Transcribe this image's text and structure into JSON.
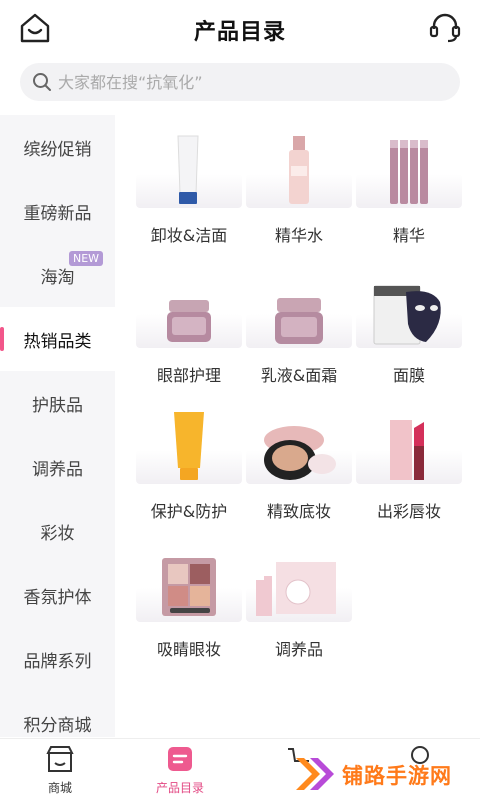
{
  "header": {
    "title": "产品目录"
  },
  "search": {
    "placeholder": "大家都在搜“抗氧化”"
  },
  "sidebar": {
    "items": [
      {
        "label": "缤纷促销"
      },
      {
        "label": "重磅新品"
      },
      {
        "label": "海淘"
      },
      {
        "label": "热销品类"
      },
      {
        "label": "护肤品"
      },
      {
        "label": "调养品"
      },
      {
        "label": "彩妆"
      },
      {
        "label": "香氛护体"
      },
      {
        "label": "品牌系列"
      },
      {
        "label": "积分商城"
      }
    ],
    "active_index": 3,
    "new_badge": "NEW"
  },
  "products": [
    {
      "label": "卸妆&洁面",
      "icon": "cleanser-tube-icon"
    },
    {
      "label": "精华水",
      "icon": "essence-bottle-icon"
    },
    {
      "label": "精华",
      "icon": "serum-vials-icon"
    },
    {
      "label": "眼部护理",
      "icon": "eye-cream-jar-icon"
    },
    {
      "label": "乳液&面霜",
      "icon": "face-cream-jar-icon"
    },
    {
      "label": "面膜",
      "icon": "sheet-mask-icon"
    },
    {
      "label": "保护&防护",
      "icon": "sunscreen-tube-icon"
    },
    {
      "label": "精致底妆",
      "icon": "cushion-compact-icon"
    },
    {
      "label": "出彩唇妆",
      "icon": "lipstick-icon"
    },
    {
      "label": "吸睛眼妆",
      "icon": "eyeshadow-palette-icon"
    },
    {
      "label": "调养品",
      "icon": "supplement-box-icon"
    }
  ],
  "bottom_nav": {
    "tabs": [
      {
        "label": "商城",
        "icon": "store-icon"
      },
      {
        "label": "产品目录",
        "icon": "catalog-icon"
      }
    ],
    "active_index": 1
  },
  "watermark": {
    "text": "铺路手游网"
  },
  "colors": {
    "accent": "#e34a84",
    "sidebar_bg": "#f6f6f8",
    "search_bg": "#f2f2f4"
  }
}
